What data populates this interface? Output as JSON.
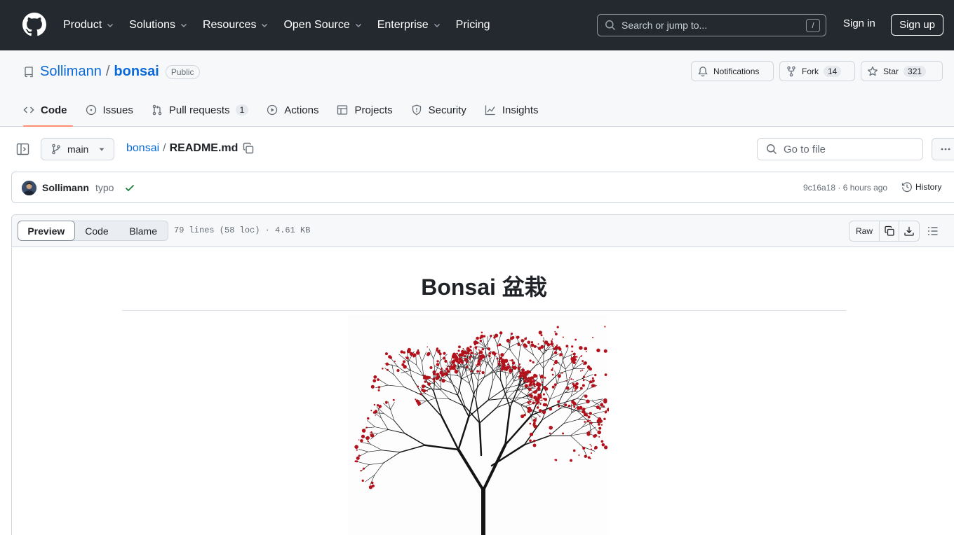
{
  "header": {
    "nav": [
      {
        "label": "Product",
        "has_dropdown": true
      },
      {
        "label": "Solutions",
        "has_dropdown": true
      },
      {
        "label": "Resources",
        "has_dropdown": true
      },
      {
        "label": "Open Source",
        "has_dropdown": true
      },
      {
        "label": "Enterprise",
        "has_dropdown": true
      },
      {
        "label": "Pricing",
        "has_dropdown": false
      }
    ],
    "search_placeholder": "Search or jump to...",
    "search_shortcut": "/",
    "sign_in": "Sign in",
    "sign_up": "Sign up"
  },
  "repo": {
    "owner": "Sollimann",
    "separator": "/",
    "name": "bonsai",
    "visibility": "Public",
    "notifications_label": "Notifications",
    "fork_label": "Fork",
    "fork_count": "14",
    "star_label": "Star",
    "star_count": "321"
  },
  "repo_nav": [
    {
      "label": "Code",
      "icon": "code-icon",
      "active": true
    },
    {
      "label": "Issues",
      "icon": "issue-icon"
    },
    {
      "label": "Pull requests",
      "icon": "pull-request-icon",
      "count": "1"
    },
    {
      "label": "Actions",
      "icon": "play-icon"
    },
    {
      "label": "Projects",
      "icon": "table-icon"
    },
    {
      "label": "Security",
      "icon": "shield-icon"
    },
    {
      "label": "Insights",
      "icon": "graph-icon"
    }
  ],
  "file_toolbar": {
    "branch": "main",
    "breadcrumb_repo": "bonsai",
    "breadcrumb_sep": "/",
    "breadcrumb_file": "README.md",
    "goto_placeholder": "Go to file"
  },
  "commit": {
    "author": "Sollimann",
    "message": "typo",
    "sha_time": "9c16a18 · 6 hours ago",
    "history_label": "History"
  },
  "file_view": {
    "tabs": [
      "Preview",
      "Code",
      "Blame"
    ],
    "active_tab": "Preview",
    "info": "79 lines (58 loc) · 4.61 KB",
    "raw_label": "Raw"
  },
  "readme": {
    "title": "Bonsai 盆栽"
  },
  "colors": {
    "header_bg": "#24292f",
    "link": "#0969da",
    "active_tab_underline": "#fd8c73",
    "success": "#1a7f37",
    "blossom": "#b3121c"
  }
}
